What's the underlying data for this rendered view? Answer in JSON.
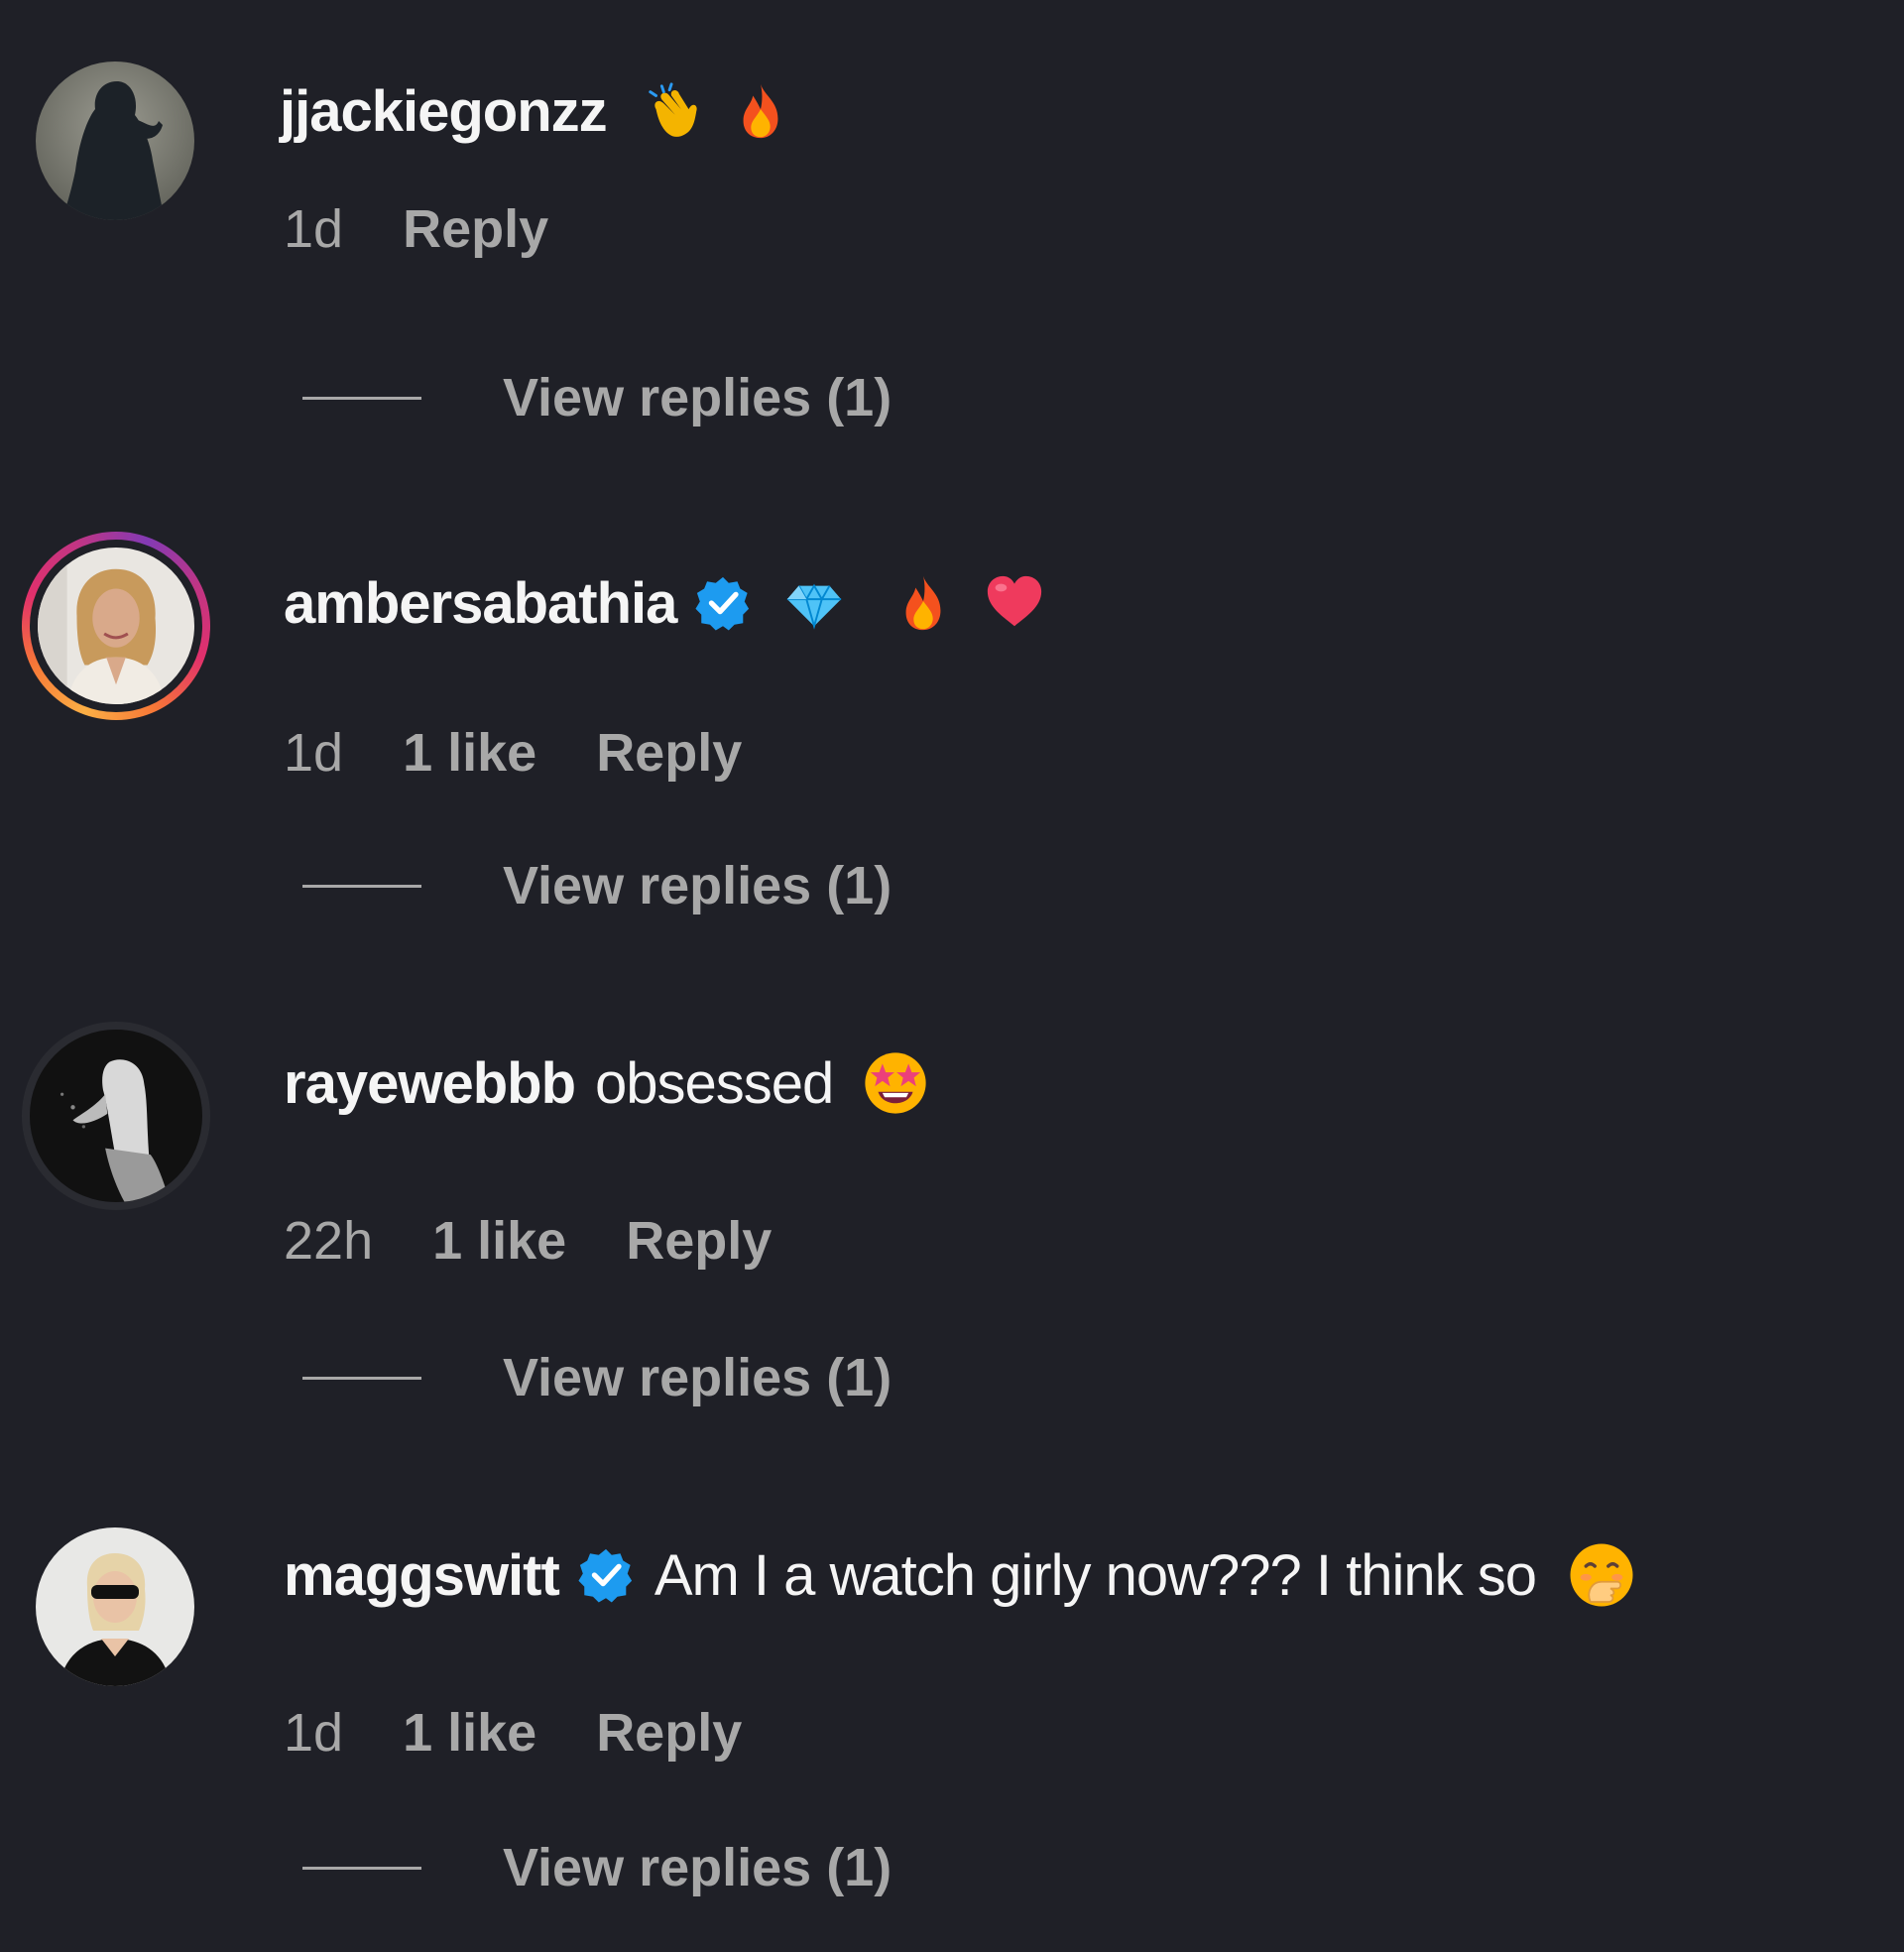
{
  "comments": [
    {
      "username": "jjackiegonzz",
      "verified": false,
      "text": "",
      "emojis": [
        "clapping-hands",
        "fire"
      ],
      "age": "1d",
      "likes": "",
      "reply_label": "Reply",
      "view_replies_label": "View replies (1)",
      "avatar": "silhouette"
    },
    {
      "username": "ambersabathia",
      "verified": true,
      "text": "",
      "emojis": [
        "gem",
        "fire",
        "red-heart"
      ],
      "age": "1d",
      "likes": "1 like",
      "reply_label": "Reply",
      "view_replies_label": "View replies (1)",
      "avatar": "story-ring"
    },
    {
      "username": "rayewebbb",
      "verified": false,
      "text": "obsessed",
      "emojis": [
        "star-struck"
      ],
      "age": "22h",
      "likes": "1 like",
      "reply_label": "Reply",
      "view_replies_label": "View replies (1)",
      "avatar": "bw-photo"
    },
    {
      "username": "maggswitt",
      "verified": true,
      "text": "Am I a watch girly now??? I think so",
      "emojis": [
        "face-with-hand-over-mouth"
      ],
      "age": "1d",
      "likes": "1 like",
      "reply_label": "Reply",
      "view_replies_label": "View replies (1)",
      "avatar": "photo"
    }
  ],
  "colors": {
    "background": "#1f2027",
    "primary_text": "#f5f5f5",
    "secondary_text": "#a8a8a8",
    "verified_blue": "#1d9bf0"
  }
}
